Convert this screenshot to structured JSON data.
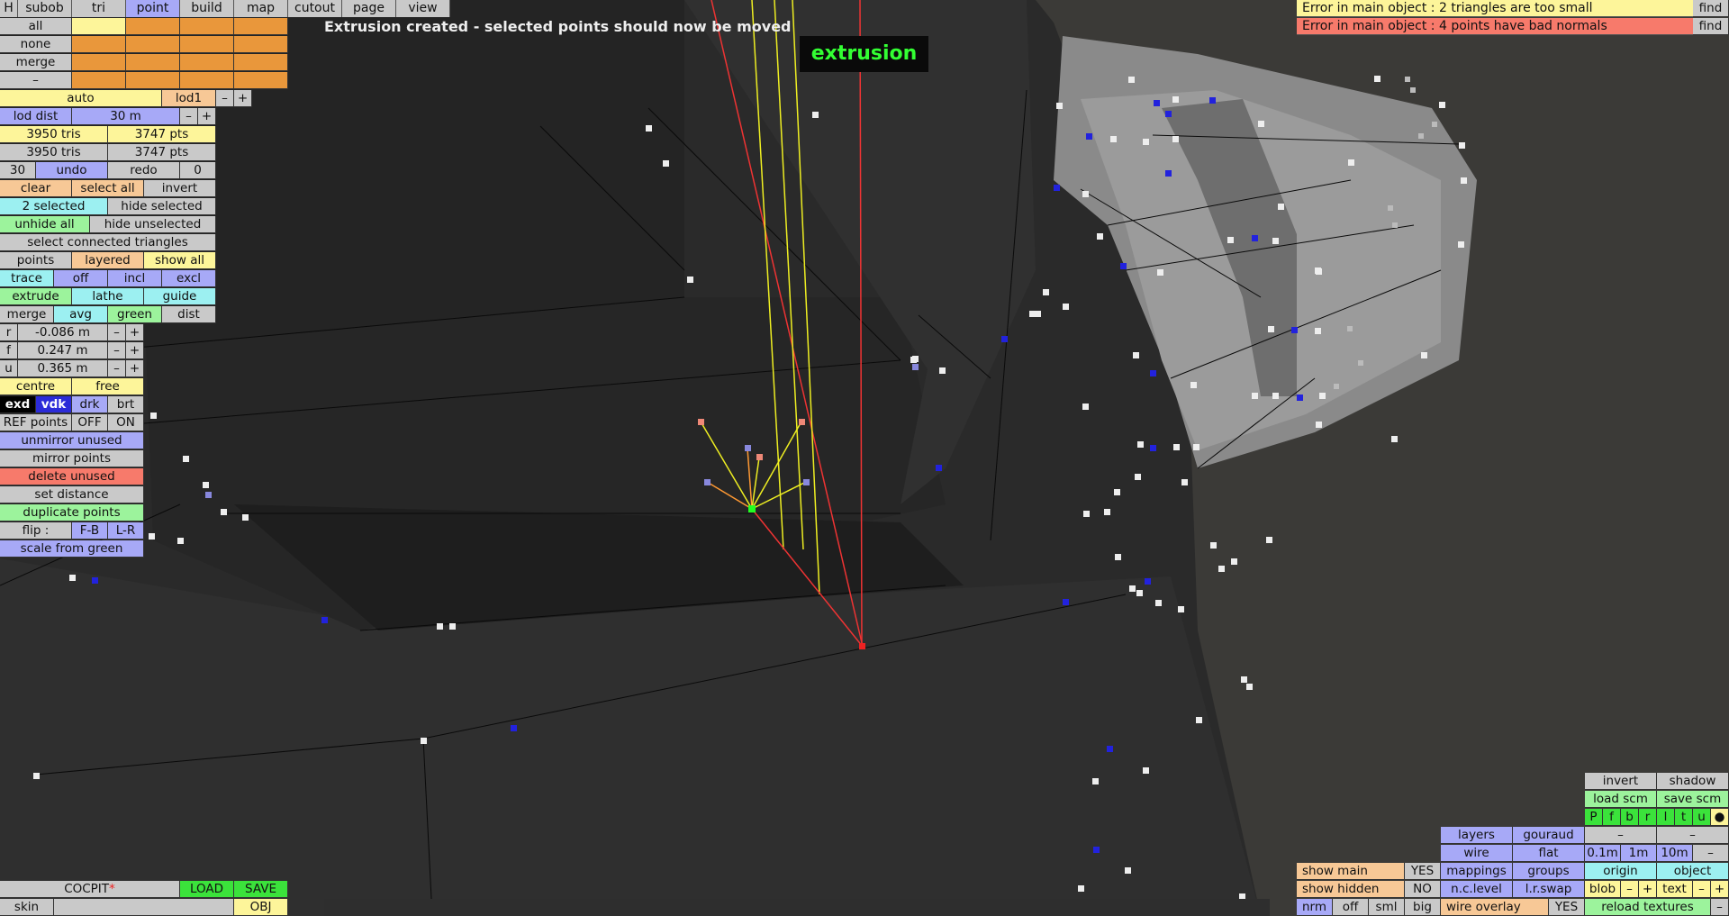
{
  "top_tabs": [
    "H",
    "subob",
    "tri",
    "point",
    "build",
    "map",
    "cutout",
    "page",
    "view"
  ],
  "selected_tab": "point",
  "message": "Extrusion created - selected points should now be moved",
  "mode_label": "extrusion",
  "errors": [
    {
      "text": "Error in main object : 2 triangles are too small",
      "action": "find"
    },
    {
      "text": "Error in main object : 4 points have bad normals",
      "action": "find"
    }
  ],
  "left": {
    "all": "all",
    "none": "none",
    "merge": "merge",
    "dash": "–",
    "auto": "auto",
    "lod1": "lod1",
    "minus": "–",
    "plus": "+",
    "lod_dist": "lod dist",
    "lod_dist_val": "30 m",
    "tris1": "3950 tris",
    "pts1": "3747 pts",
    "tris2": "3950 tris",
    "pts2": "3747 pts",
    "undo_count": "30",
    "undo": "undo",
    "redo": "redo",
    "redo_count": "0",
    "clear": "clear",
    "select_all": "select all",
    "invert": "invert",
    "selected": "2 selected",
    "hide_selected": "hide selected",
    "unhide_all": "unhide all",
    "hide_unselected": "hide unselected",
    "select_connected": "select connected triangles",
    "points": "points",
    "layered": "layered",
    "show_all": "show all",
    "trace": "trace",
    "off": "off",
    "incl": "incl",
    "excl": "excl",
    "extrude": "extrude",
    "lathe": "lathe",
    "guide": "guide",
    "merge2": "merge",
    "avg": "avg",
    "green": "green",
    "dist": "dist",
    "r": "r",
    "r_val": "-0.086 m",
    "f": "f",
    "f_val": "0.247 m",
    "u": "u",
    "u_val": "0.365 m",
    "centre": "centre",
    "free": "free",
    "exd": "exd",
    "vdk": "vdk",
    "drk": "drk",
    "brt": "brt",
    "ref_points": "REF points",
    "ref_off": "OFF",
    "ref_on": "ON",
    "unmirror": "unmirror unused",
    "mirror": "mirror points",
    "delete_unused": "delete unused",
    "set_distance": "set distance",
    "duplicate": "duplicate points",
    "flip": "flip :",
    "fb": "F-B",
    "lr": "L-R",
    "scale_green": "scale from green"
  },
  "bottom_left": {
    "name": "COCPIT",
    "modified": "*",
    "load": "LOAD",
    "save": "SAVE",
    "skin": "skin",
    "obj": "OBJ"
  },
  "bottom_right": {
    "invert": "invert",
    "shadow": "shadow",
    "load_scm": "load scm",
    "save_scm": "save scm",
    "channels": [
      "P",
      "f",
      "b",
      "r",
      "l",
      "t",
      "u"
    ],
    "dot": "●",
    "dash1": "–",
    "dash2": "–",
    "layers": "layers",
    "gouraud": "gouraud",
    "wire": "wire",
    "flat": "flat",
    "s01": "0.1m",
    "s1": "1m",
    "s10": "10m",
    "sminus": "–",
    "show_main": "show main",
    "yes1": "YES",
    "mappings": "mappings",
    "groups": "groups",
    "origin": "origin",
    "object": "object",
    "show_hidden": "show hidden",
    "no": "NO",
    "nclevel": "n.c.level",
    "lrswap": "l.r.swap",
    "blob": "blob",
    "text": "text",
    "minus": "–",
    "plus": "+",
    "nrm": "nrm",
    "off": "off",
    "sml": "sml",
    "big": "big",
    "wire_overlay": "wire overlay",
    "yes2": "YES",
    "reload": "reload textures",
    "rminus": "–"
  }
}
